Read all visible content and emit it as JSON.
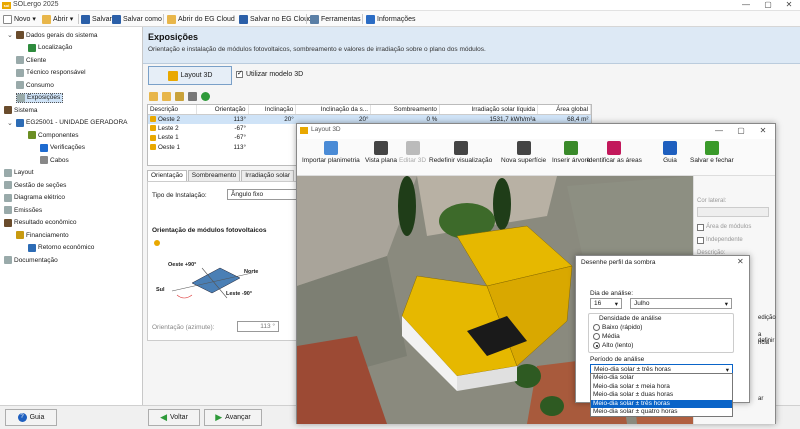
{
  "app": {
    "title": "SOLergo 2025",
    "logo": "sol",
    "controls": [
      "—",
      "▢",
      "✕"
    ]
  },
  "toolbar": {
    "novo": "Novo",
    "abrir": "Abrir",
    "salvar": "Salvar",
    "salvar_como": "Salvar como",
    "abrir_cloud": "Abrir do EG Cloud",
    "salvar_cloud": "Salvar no EG Cloud",
    "ferramentas": "Ferramentas",
    "informacoes": "Informações"
  },
  "tree": {
    "items": [
      {
        "label": "Dados gerais do sistema",
        "icon": "building-icon",
        "color": "#6a4c2c"
      },
      {
        "label": "Localização",
        "icon": "map-icon",
        "color": "#2e8b3d"
      },
      {
        "label": "Cliente",
        "icon": "doc-icon",
        "color": "#9aa"
      },
      {
        "label": "Técnico responsável",
        "icon": "doc-icon",
        "color": "#9aa"
      },
      {
        "label": "Consumo",
        "icon": "doc-icon",
        "color": "#9aa"
      },
      {
        "label": "Exposições",
        "icon": "doc-icon",
        "color": "#9aa"
      },
      {
        "label": "Sistema",
        "icon": "building-icon",
        "color": "#6a4c2c"
      },
      {
        "label": "EG25001 - UNIDADE GERADORA",
        "icon": "grid-icon",
        "color": "#2d6cb5"
      },
      {
        "label": "Componentes",
        "icon": "components-icon",
        "color": "#6b8e23"
      },
      {
        "label": "Verificações",
        "icon": "check-icon",
        "color": "#1e6bd0"
      },
      {
        "label": "Cabos",
        "icon": "cable-icon",
        "color": "#888"
      },
      {
        "label": "Layout",
        "icon": "doc-icon",
        "color": "#9aa"
      },
      {
        "label": "Gestão de seções",
        "icon": "doc-icon",
        "color": "#9aa"
      },
      {
        "label": "Diagrama elétrico",
        "icon": "doc-icon",
        "color": "#9aa"
      },
      {
        "label": "Emissões",
        "icon": "doc-icon",
        "color": "#9aa"
      },
      {
        "label": "Resultado econômico",
        "icon": "building-icon",
        "color": "#6a4c2c"
      },
      {
        "label": "Financiamento",
        "icon": "money-icon",
        "color": "#c89a10"
      },
      {
        "label": "Retorno econômico",
        "icon": "chart-icon",
        "color": "#2d6cb5"
      },
      {
        "label": "Documentação",
        "icon": "doc-icon",
        "color": "#9aa"
      }
    ]
  },
  "main": {
    "title": "Exposições",
    "subtitle": "Orientação e instalação de módulos fotovoltaicos, sombreamento e valores de irradiação sobre o plano dos módulos.",
    "layout3d_button": "Layout 3D",
    "use_3d_label": "Utilizar modelo 3D",
    "table": {
      "headers": [
        "Descrição",
        "Orientação",
        "Inclinação",
        "Inclinação da s...",
        "Sombreamento",
        "Irradiação solar líquida",
        "Área global"
      ],
      "rows": [
        [
          "Oeste 2",
          "113°",
          "20°",
          "20°",
          "0 %",
          "1531,7 kWh/m²a",
          "68,4 m²"
        ],
        [
          "Leste 2",
          "-67°",
          "",
          "",
          "",
          "",
          ""
        ],
        [
          "Leste 1",
          "-67°",
          "",
          "",
          "",
          "",
          ""
        ],
        [
          "Oeste 1",
          "113°",
          "",
          "",
          "",
          "",
          ""
        ]
      ]
    },
    "tabs": [
      "Orientação",
      "Sombreamento",
      "Irradiação solar"
    ],
    "install_label": "Tipo de Instalação:",
    "install_value": "Ângulo fixo",
    "orient_title": "Orientação de módulos fotovoltaicos",
    "compass": {
      "oeste": "Oeste +90°",
      "norte": "Norte",
      "sul": "Sul",
      "leste": "Leste -90°"
    },
    "azimuth_label": "Orientação (azimute):",
    "azimuth_value": "113 °"
  },
  "bottom": {
    "guia": "Guia",
    "voltar": "Voltar",
    "avancar": "Avançar"
  },
  "layout3d": {
    "title": "Layout 3D",
    "ribbon": [
      {
        "label": "Importar planimetria",
        "icon": "image-icon",
        "color": "#4a8bd6"
      },
      {
        "label": "Vista plana",
        "icon": "house-icon",
        "color": "#444"
      },
      {
        "label": "Editar 3D",
        "icon": "box3d-icon",
        "color": "#bbb"
      },
      {
        "label": "Redefinir visualização",
        "icon": "reset-icon",
        "color": "#444"
      },
      {
        "label": "Nova superfície",
        "icon": "surface-icon",
        "color": "#444"
      },
      {
        "label": "Inserir árvore",
        "icon": "tree-icon",
        "color": "#3a8a2a"
      },
      {
        "label": "Identificar as áreas",
        "icon": "area-icon",
        "color": "#c2185b"
      },
      {
        "label": "Guia",
        "icon": "help-icon",
        "color": "#1e5fbf"
      },
      {
        "label": "Salvar e fechar",
        "icon": "check-icon",
        "color": "#3a9a2a"
      }
    ],
    "right": {
      "cor_lateral": "Cor lateral:",
      "area_modulos": "Área de módulos",
      "independente": "Independente",
      "descricao": "Descrição:",
      "frag1": "edição",
      "frag2": "a definir",
      "frag3": "ncia",
      "frag4": "ar"
    }
  },
  "shadow_dialog": {
    "title": "Desenhe perfil da sombra",
    "day_label": "Dia de análise:",
    "day_value": "16",
    "month_value": "Julho",
    "density_label": "Densidade de análise",
    "density_options": [
      "Baixo (rápido)",
      "Média",
      "Alto (lento)"
    ],
    "density_selected": 2,
    "period_label": "Período de análise",
    "period_value": "Meio-dia solar ± três horas",
    "period_options": [
      "Meio-dia solar",
      "Meio-dia solar ± meia hora",
      "Meio-dia solar ± duas horas",
      "Meio-dia solar ± três horas",
      "Meio-dia solar ± quatro horas"
    ],
    "period_selected": 3
  }
}
